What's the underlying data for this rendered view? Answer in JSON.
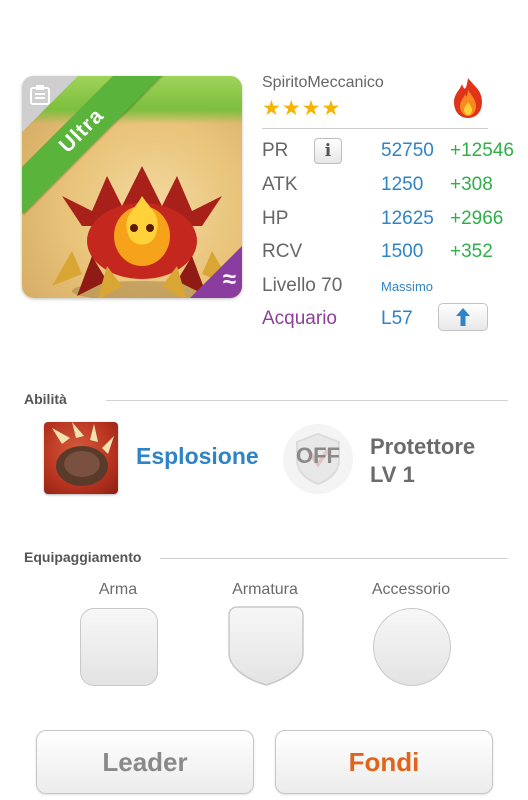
{
  "monster": {
    "rank_label": "Ultra",
    "name": "SpiritoMeccanico",
    "stars": "★★★★",
    "element_icon": "fire-icon",
    "subelement_icon": "water-icon"
  },
  "stats": {
    "pr": {
      "label": "PR",
      "value": "52750",
      "bonus": "+12546"
    },
    "atk": {
      "label": "ATK",
      "value": "1250",
      "bonus": "+308"
    },
    "hp": {
      "label": "HP",
      "value": "12625",
      "bonus": "+2966"
    },
    "rcv": {
      "label": "RCV",
      "value": "1500",
      "bonus": "+352"
    },
    "level": {
      "label": "Livello 70",
      "value": "Massimo"
    },
    "aquarius": {
      "label": "Acquario",
      "value": "L57"
    }
  },
  "abilities": {
    "title": "Abilità",
    "active_skill": "Esplosione",
    "leader_toggle": "OFF",
    "leader_skill_line1": "Protettore",
    "leader_skill_line2": "LV 1"
  },
  "equipment": {
    "title": "Equipaggiamento",
    "weapon": "Arma",
    "armor": "Armatura",
    "accessory": "Accessorio"
  },
  "buttons": {
    "leader": "Leader",
    "fuse": "Fondi"
  },
  "colors": {
    "blue": "#2f84c7",
    "green": "#2fb049",
    "purple": "#8d3f99",
    "orange": "#e0641b",
    "ultra_ribbon": "#5ab33a"
  }
}
